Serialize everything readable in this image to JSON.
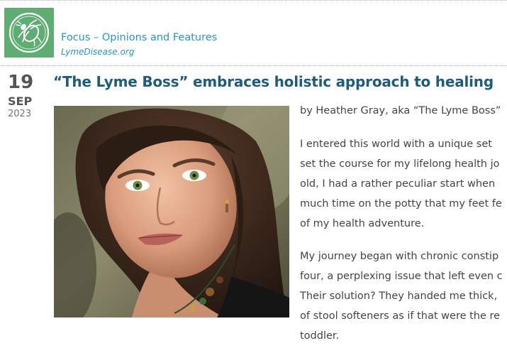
{
  "header": {
    "section_title": "Focus – Opinions and Features",
    "section_subtitle": "LymeDisease.org",
    "logo_icon": "tick-logo-icon",
    "logo_color": "#5fad72",
    "title_color": "#2795c8"
  },
  "post": {
    "date": {
      "day": "19",
      "month": "SEP",
      "year": "2023"
    },
    "title": "“The Lyme Boss” embraces holistic approach to healing",
    "title_color": "#1f5c79",
    "image_alt": "portrait-photo",
    "byline": "by Heather Gray, aka “The Lyme Boss”",
    "paragraphs": [
      {
        "lines": [
          "I entered this world with a unique set",
          "set the course for my lifelong health jo",
          "old, I had a rather peculiar start when",
          "much time on the potty that my feet fe",
          "of my health adventure."
        ]
      },
      {
        "lines": [
          "My journey began with chronic constip",
          "four, a perplexing issue that left even c",
          "Their solution? They handed me thick,",
          "of stool softeners as if that were the re",
          "toddler."
        ]
      }
    ]
  }
}
